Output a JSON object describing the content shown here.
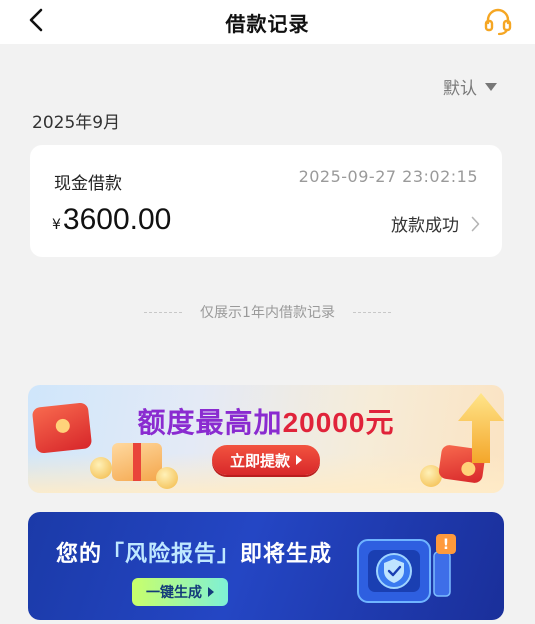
{
  "header": {
    "title": "借款记录",
    "back_icon": "chevron-left-icon",
    "support_icon": "headset-icon"
  },
  "sort": {
    "label": "默认",
    "icon": "caret-down-icon"
  },
  "records": {
    "month": "2025年9月",
    "items": [
      {
        "type": "现金借款",
        "time": "2025-09-27 23:02:15",
        "currency": "¥",
        "amount": "3600.00",
        "status": "放款成功"
      }
    ]
  },
  "notice": {
    "text": "仅展示1年内借款记录"
  },
  "promo": {
    "headline_prefix": "额度最高加",
    "headline_number": "20000",
    "headline_suffix": "元",
    "button_label": "立即提款"
  },
  "risk_banner": {
    "headline_before": "您的",
    "headline_highlight": "「风险报告」",
    "headline_after": "即将生成",
    "button_label": "一键生成"
  },
  "colors": {
    "accent_orange": "#f5a623",
    "promo_red": "#e0233a",
    "promo_purple": "#8a2bd0",
    "risk_blue": "#2446c4"
  }
}
